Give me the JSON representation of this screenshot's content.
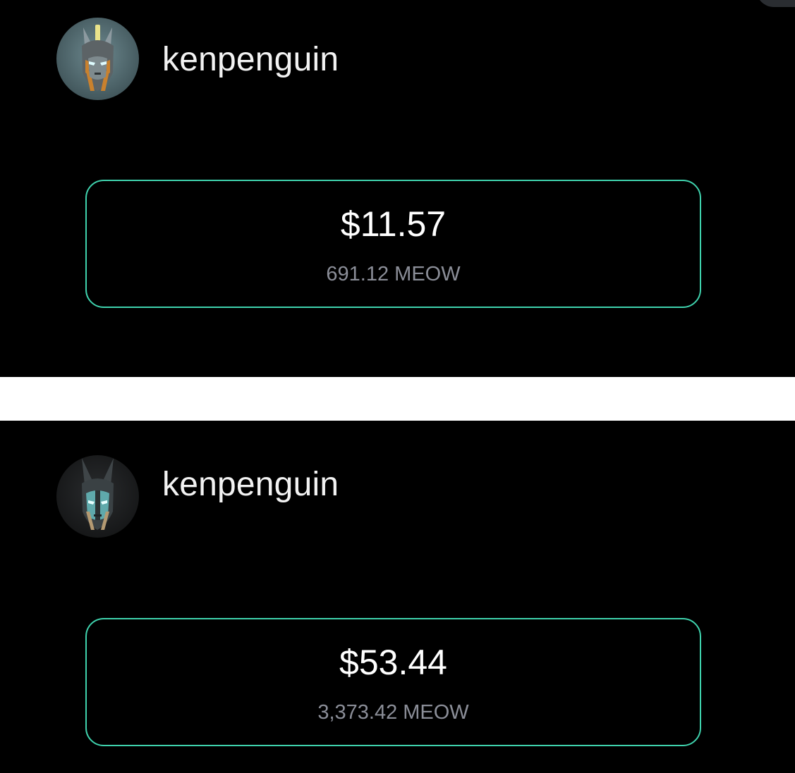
{
  "colors": {
    "background": "#000000",
    "separator": "#ffffff",
    "card_border": "#3fd2ad",
    "primary_text": "#ffffff",
    "secondary_text": "#8b8e98"
  },
  "screens": [
    {
      "avatar_icon": "knight-helmet-avatar-icon",
      "username": "kenpenguin",
      "balance_usd": "$11.57",
      "balance_meow": "691.12 MEOW"
    },
    {
      "avatar_icon": "knight-helmet-avatar-icon",
      "username": "kenpenguin",
      "balance_usd": "$53.44",
      "balance_meow": "3,373.42 MEOW"
    }
  ]
}
